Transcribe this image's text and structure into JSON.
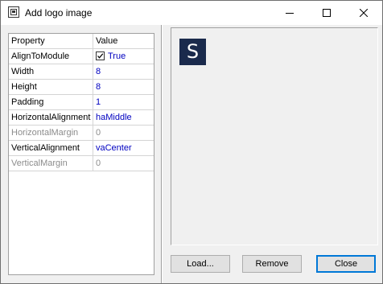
{
  "window": {
    "title": "Add logo image"
  },
  "grid": {
    "header": {
      "property": "Property",
      "value": "Value"
    },
    "rows": [
      {
        "name": "AlignToModule",
        "value": "True",
        "checkbox": true,
        "disabled": false
      },
      {
        "name": "Width",
        "value": "8",
        "disabled": false
      },
      {
        "name": "Height",
        "value": "8",
        "disabled": false
      },
      {
        "name": "Padding",
        "value": "1",
        "disabled": false
      },
      {
        "name": "HorizontalAlignment",
        "value": "haMiddle",
        "disabled": false
      },
      {
        "name": "HorizontalMargin",
        "value": "0",
        "disabled": true
      },
      {
        "name": "VerticalAlignment",
        "value": "vaCenter",
        "disabled": false
      },
      {
        "name": "VerticalMargin",
        "value": "0",
        "disabled": true
      }
    ]
  },
  "preview": {
    "logo_letter": "S",
    "logo_color": "#1a2a4c"
  },
  "buttons": {
    "load": "Load...",
    "remove": "Remove",
    "close": "Close"
  }
}
